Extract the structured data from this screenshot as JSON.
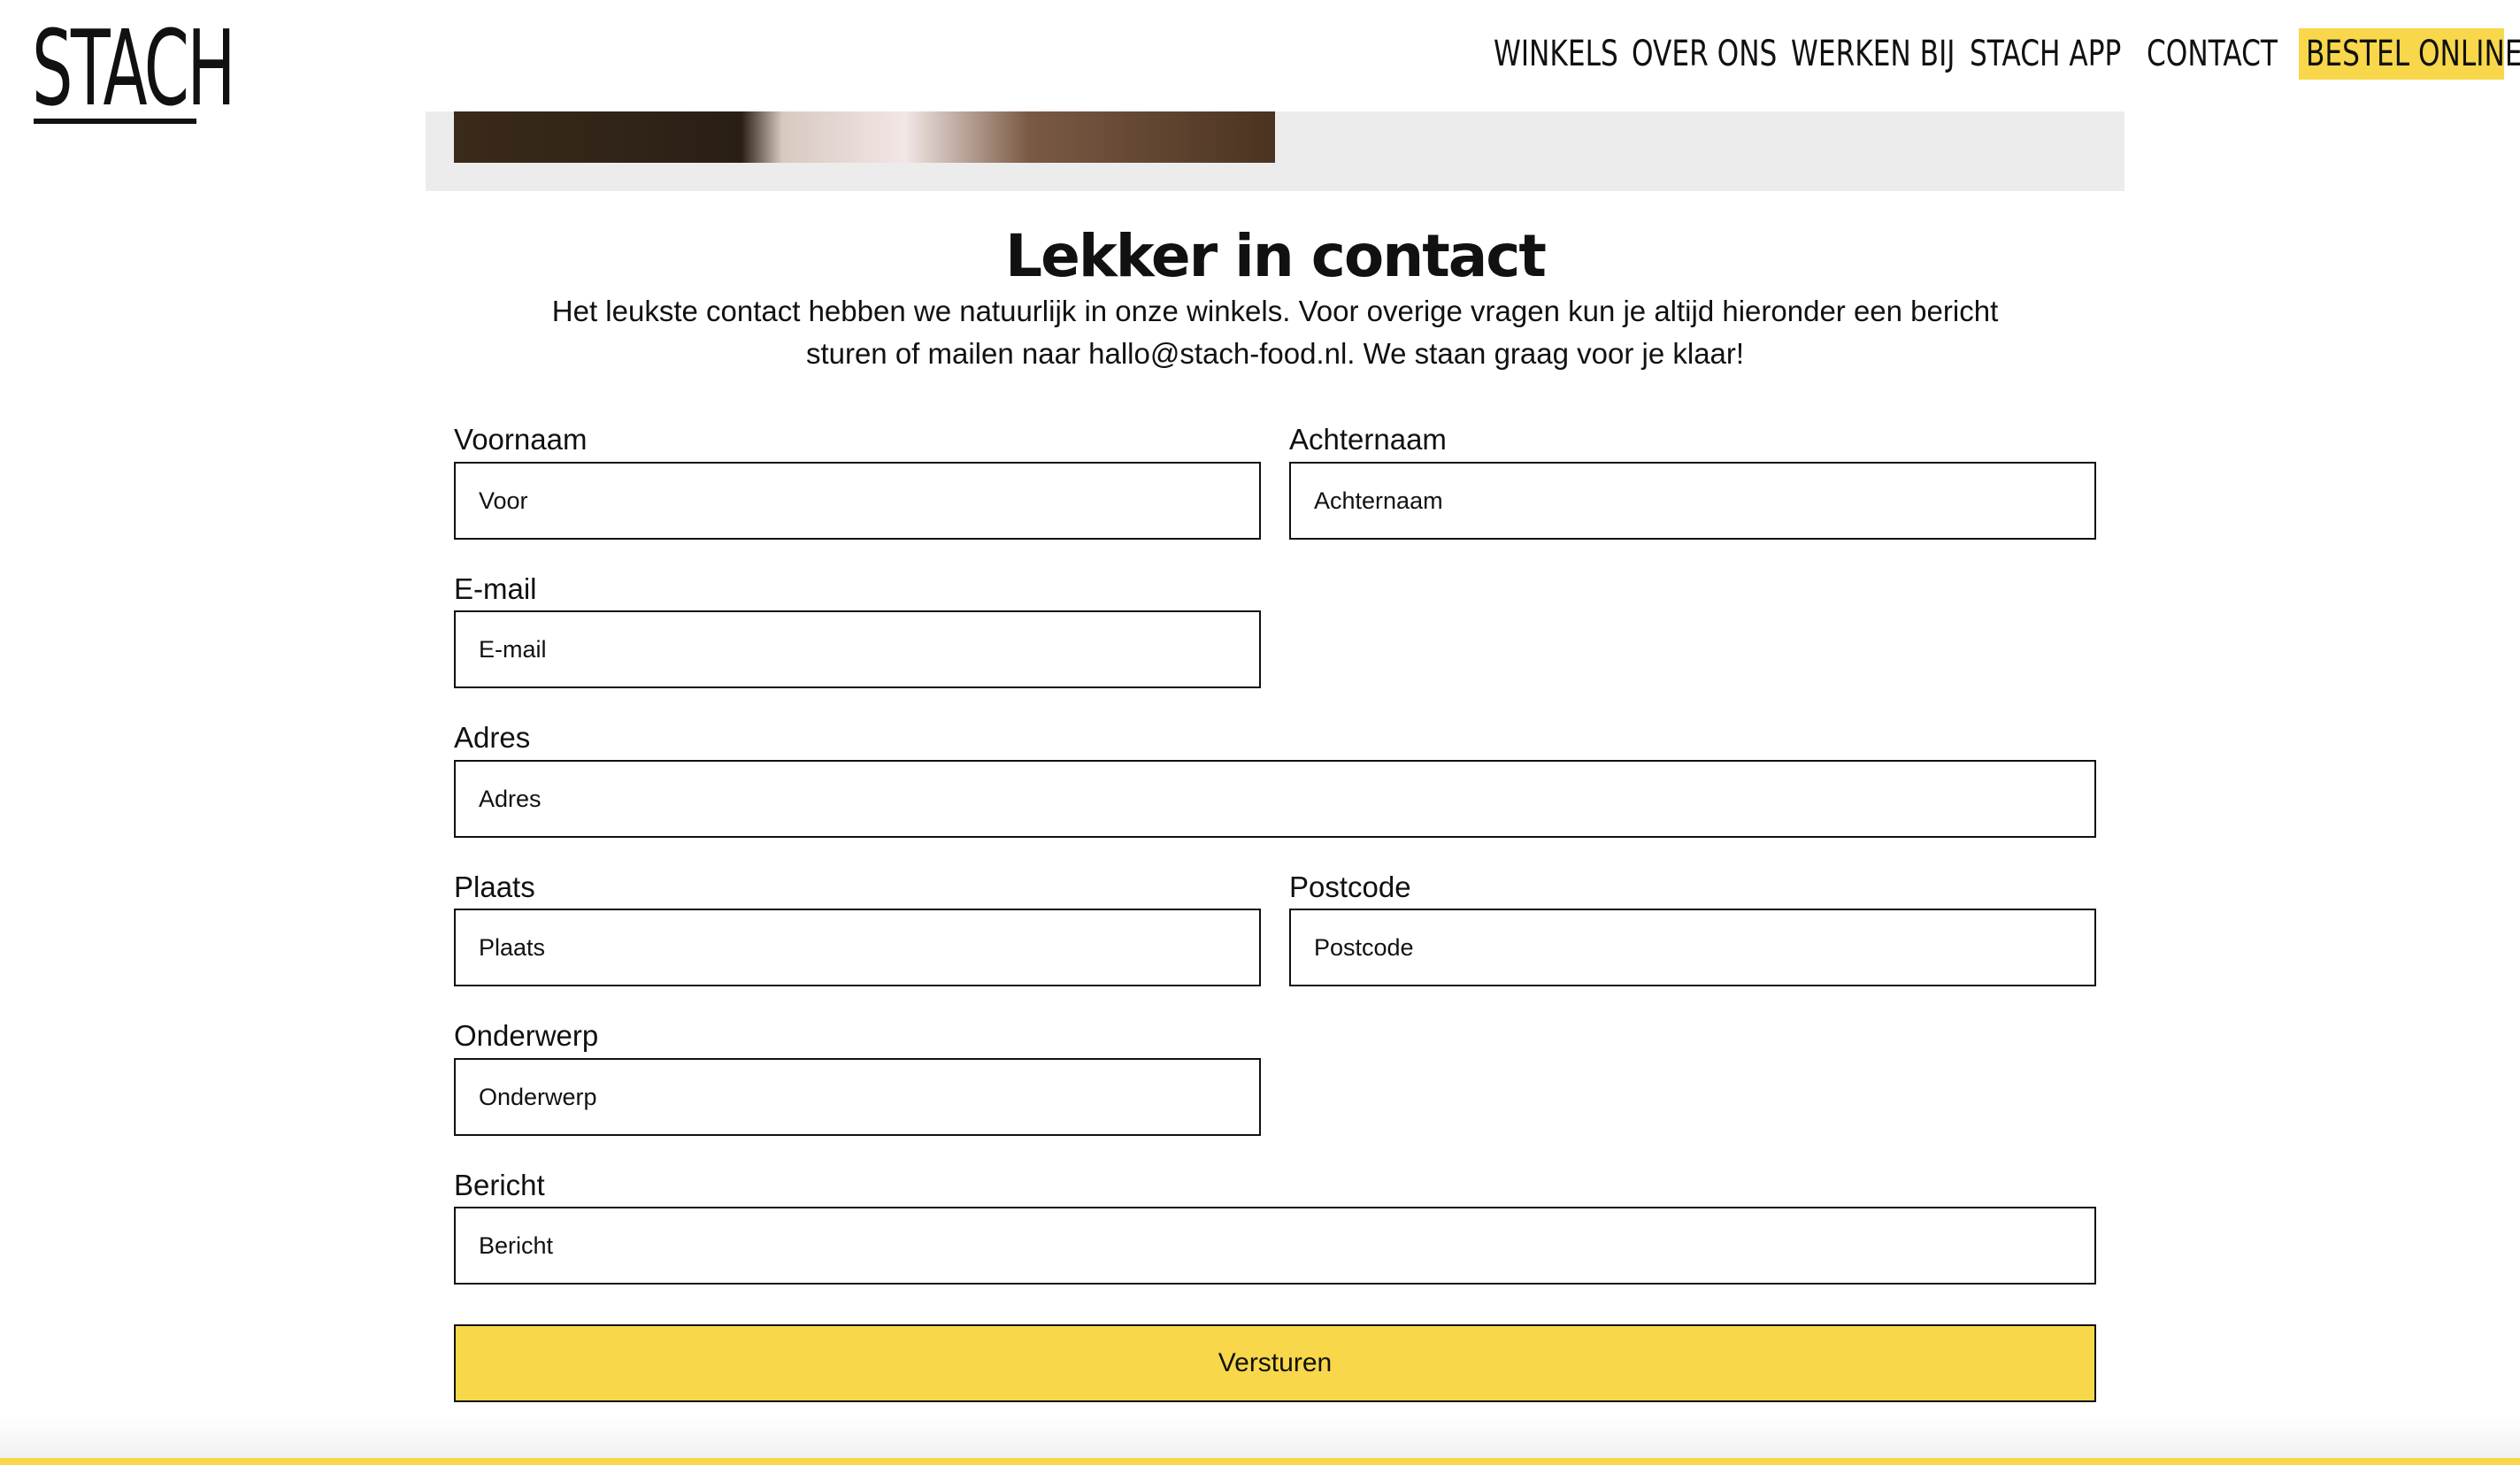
{
  "brand": {
    "logo_text": "STACH"
  },
  "nav": {
    "items": [
      {
        "label": "WINKELS"
      },
      {
        "label": "OVER ONS"
      },
      {
        "label": "WERKEN BIJ"
      },
      {
        "label": "STACH APP"
      },
      {
        "label": "CONTACT"
      }
    ],
    "cta_label": "BESTEL ONLINE"
  },
  "contact": {
    "title": "Lekker in contact",
    "intro_line1": "Het leukste contact hebben we natuurlijk in onze winkels. Voor overige vragen kun je altijd hieronder een bericht",
    "intro_line2": "sturen of mailen naar hallo@stach-food.nl. We staan graag voor je klaar!"
  },
  "form": {
    "first_name": {
      "label": "Voornaam",
      "placeholder": "Voor"
    },
    "last_name": {
      "label": "Achternaam",
      "placeholder": "Achternaam"
    },
    "email": {
      "label": "E-mail",
      "placeholder": "E-mail"
    },
    "address": {
      "label": "Adres",
      "placeholder": "Adres"
    },
    "city": {
      "label": "Plaats",
      "placeholder": "Plaats"
    },
    "postcode": {
      "label": "Postcode",
      "placeholder": "Postcode"
    },
    "subject": {
      "label": "Onderwerp",
      "placeholder": "Onderwerp"
    },
    "message": {
      "label": "Bericht",
      "placeholder": "Bericht"
    },
    "submit_label": "Versturen"
  },
  "colors": {
    "accent": "#f8d84a",
    "text": "#111111",
    "hero_band": "#ececec"
  }
}
